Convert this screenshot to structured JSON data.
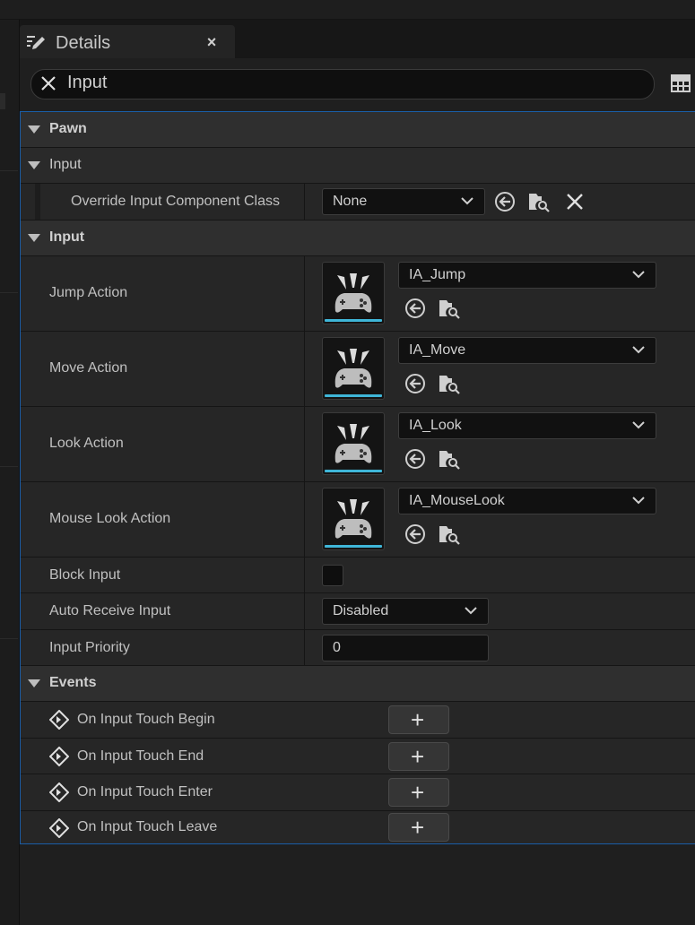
{
  "tab": {
    "title": "Details",
    "close_glyph": "×"
  },
  "search": {
    "value": "Input",
    "clear_icon": "x-icon"
  },
  "sections": {
    "pawn": {
      "title": "Pawn"
    },
    "pawn_input": {
      "title": "Input",
      "override_label": "Override Input Component Class",
      "override_value": "None"
    },
    "input": {
      "title": "Input",
      "actions": [
        {
          "label": "Jump Action",
          "value": "IA_Jump"
        },
        {
          "label": "Move Action",
          "value": "IA_Move"
        },
        {
          "label": "Look Action",
          "value": "IA_Look"
        },
        {
          "label": "Mouse Look Action",
          "value": "IA_MouseLook"
        }
      ],
      "block_input_label": "Block Input",
      "block_input_checked": false,
      "auto_receive_label": "Auto Receive Input",
      "auto_receive_value": "Disabled",
      "priority_label": "Input Priority",
      "priority_value": "0"
    },
    "events": {
      "title": "Events",
      "items": [
        {
          "label": "On Input Touch Begin"
        },
        {
          "label": "On Input Touch End"
        },
        {
          "label": "On Input Touch Enter"
        },
        {
          "label": "On Input Touch Leave"
        }
      ],
      "add_glyph": "+"
    }
  },
  "colors": {
    "accent": "#3fb6d8",
    "selection_border": "#1a5ea8"
  }
}
